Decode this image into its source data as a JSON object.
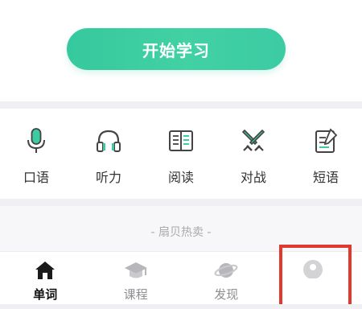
{
  "start_button": {
    "label": "开始学习"
  },
  "features": [
    {
      "label": "口语",
      "icon": "microphone-icon"
    },
    {
      "label": "听力",
      "icon": "headphones-icon"
    },
    {
      "label": "阅读",
      "icon": "book-icon"
    },
    {
      "label": "对战",
      "icon": "crossed-swords-icon"
    },
    {
      "label": "短语",
      "icon": "note-edit-icon"
    }
  ],
  "promo": {
    "title": "- 扇贝热卖 -"
  },
  "tabbar": {
    "active_index": 0,
    "tabs": [
      {
        "label": "单词",
        "icon": "home-icon"
      },
      {
        "label": "课程",
        "icon": "graduation-cap-icon"
      },
      {
        "label": "发现",
        "icon": "planet-icon"
      },
      {
        "label": "",
        "icon": "profile-icon"
      }
    ]
  },
  "colors": {
    "accent_green": "#3ccba3",
    "highlight_red": "#e03a2f",
    "separator": "#f0eff4",
    "text_dark": "#333333",
    "text_muted": "#8e8e93"
  }
}
